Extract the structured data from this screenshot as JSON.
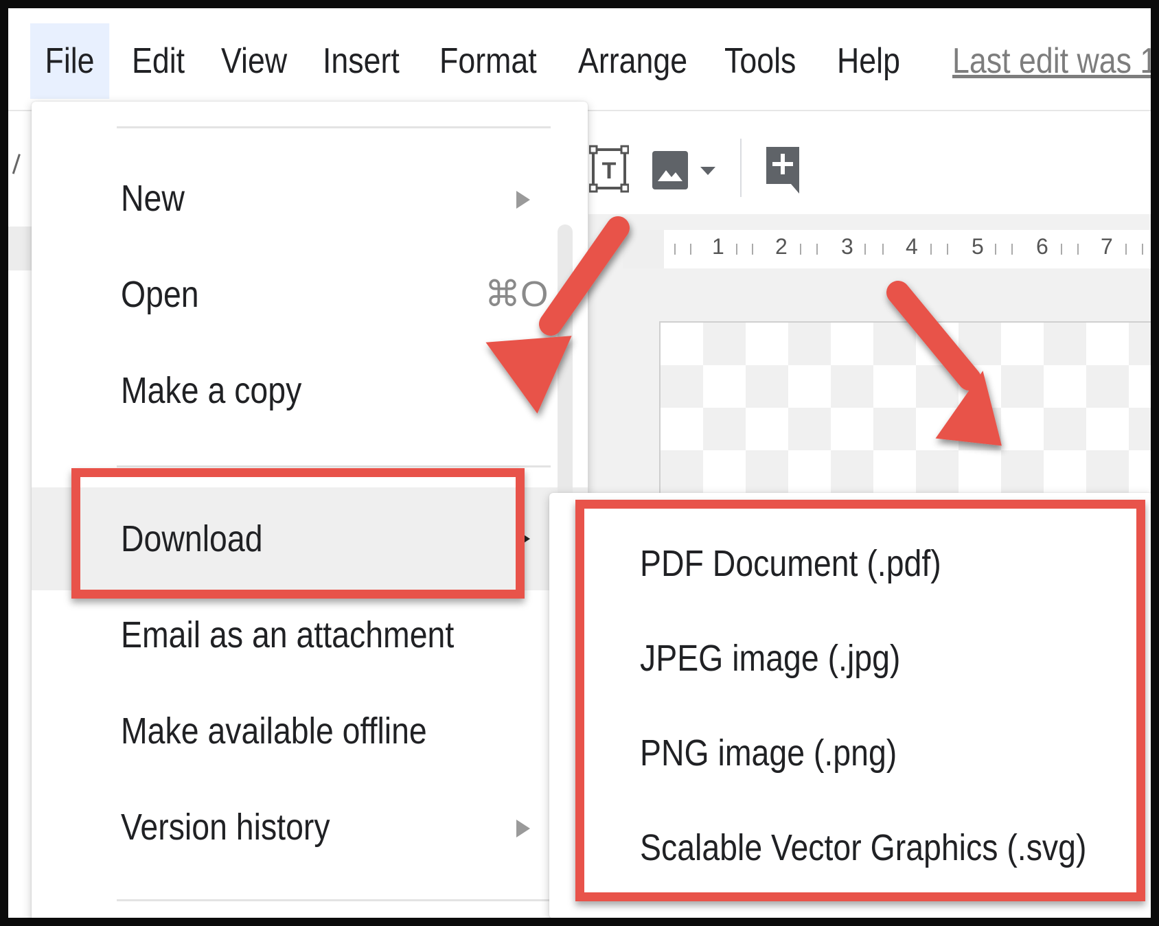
{
  "menubar": {
    "items": [
      "File",
      "Edit",
      "View",
      "Insert",
      "Format",
      "Arrange",
      "Tools",
      "Help"
    ],
    "last_edit": "Last edit was 1"
  },
  "toolbar": {
    "icons": [
      "text-box-icon",
      "image-icon",
      "dropdown-caret-icon",
      "add-comment-icon"
    ]
  },
  "ruler": {
    "numbers": [
      "1",
      "2",
      "3",
      "4",
      "5",
      "6",
      "7"
    ]
  },
  "file_menu": {
    "items": [
      {
        "label": "New",
        "has_submenu": true
      },
      {
        "label": "Open",
        "shortcut": "⌘O"
      },
      {
        "label": "Make a copy"
      },
      {
        "label": "Download",
        "has_submenu": true,
        "hovered": true
      },
      {
        "label": "Email as an attachment"
      },
      {
        "label": "Make available offline"
      },
      {
        "label": "Version history",
        "has_submenu": true
      }
    ]
  },
  "download_submenu": {
    "items": [
      "PDF Document (.pdf)",
      "JPEG image (.jpg)",
      "PNG image (.png)",
      "Scalable Vector Graphics (.svg)"
    ]
  },
  "colors": {
    "highlight": "#e8534a",
    "active_menu_bg": "#e8f0fe",
    "hover_bg": "#efefef"
  }
}
